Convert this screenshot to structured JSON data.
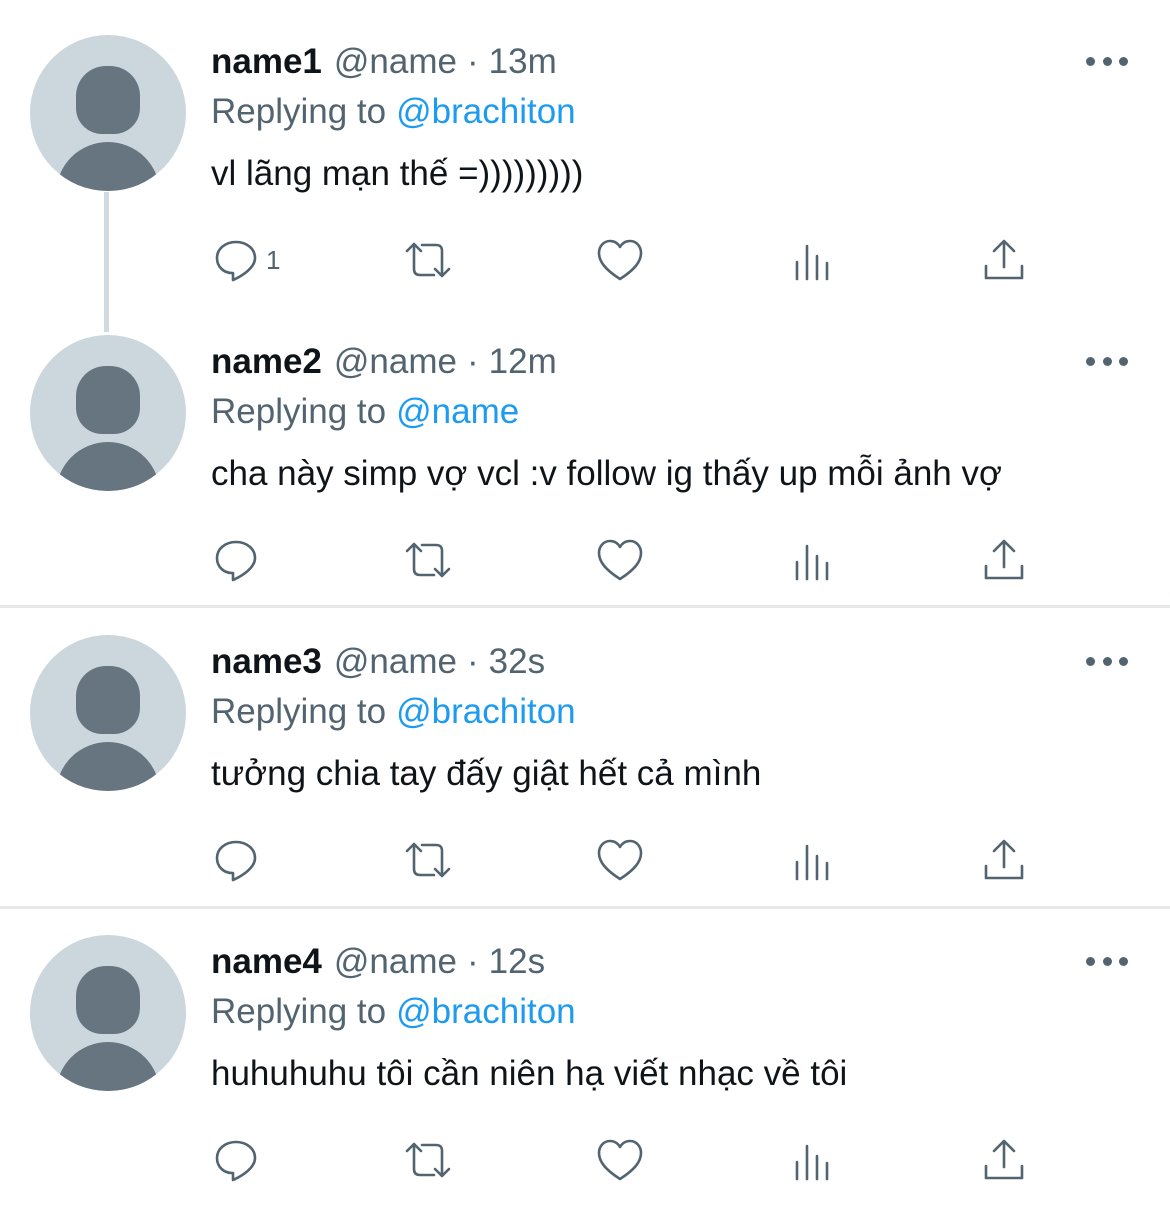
{
  "tweets": [
    {
      "name": "name1",
      "handle": "@name",
      "separator": "·",
      "time": "13m",
      "replying_prefix": "Replying to",
      "replying_to": "@brachiton",
      "text": "vl lãng mạn thế =)))))))))",
      "reply_count": "1"
    },
    {
      "name": "name2",
      "handle": "@name",
      "separator": "·",
      "time": "12m",
      "replying_prefix": "Replying to",
      "replying_to": "@name",
      "text": "cha này simp vợ vcl :v follow ig thấy up mỗi ảnh vợ",
      "reply_count": ""
    },
    {
      "name": "name3",
      "handle": "@name",
      "separator": "·",
      "time": "32s",
      "replying_prefix": "Replying to",
      "replying_to": "@brachiton",
      "text": "tưởng chia tay đấy giật hết cả mình",
      "reply_count": ""
    },
    {
      "name": "name4",
      "handle": "@name",
      "separator": "·",
      "time": "12s",
      "replying_prefix": "Replying to",
      "replying_to": "@brachiton",
      "text": "huhuhuhu tôi cần niên hạ viết nhạc về tôi",
      "reply_count": ""
    }
  ],
  "icons": {
    "reply": "reply-icon",
    "retweet": "retweet-icon",
    "like": "like-icon",
    "views": "views-icon",
    "share": "share-icon",
    "more": "more-icon"
  },
  "colors": {
    "text_primary": "#0f1419",
    "text_secondary": "#536471",
    "mention": "#1d9bf0",
    "avatar_bg": "#ccd6dd",
    "avatar_fg": "#66757f",
    "divider": "#e6e8ea"
  }
}
